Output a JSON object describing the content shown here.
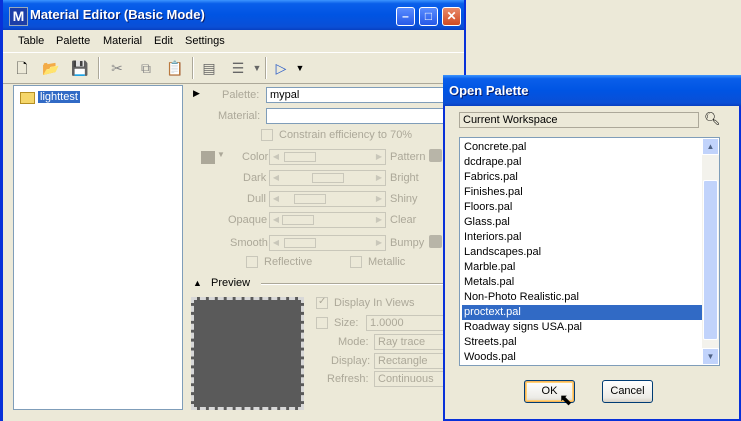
{
  "main": {
    "title": "Material Editor (Basic Mode)",
    "app_icon": "M",
    "menu": [
      "Table",
      "Palette",
      "Material",
      "Edit",
      "Settings"
    ],
    "tree": {
      "selected": "lighttest"
    },
    "form": {
      "palette_label": "Palette:",
      "palette_value": "mypal",
      "material_label": "Material:",
      "material_value": "",
      "constrain_label": "Constrain efficiency to 70%",
      "color_label": "Color",
      "pattern_label": "Pattern",
      "dark_label": "Dark",
      "bright_label": "Bright",
      "dull_label": "Dull",
      "shiny_label": "Shiny",
      "opaque_label": "Opaque",
      "clear_label": "Clear",
      "smooth_label": "Smooth",
      "bumpy_label": "Bumpy",
      "reflective_label": "Reflective",
      "metallic_label": "Metallic"
    },
    "preview": {
      "header": "Preview",
      "display_in_views": "Display In Views",
      "size_label": "Size:",
      "size_value": "1.0000",
      "mode_label": "Mode:",
      "mode_value": "Ray trace",
      "display_label": "Display:",
      "display_value": "Rectangle",
      "refresh_label": "Refresh:",
      "refresh_value": "Continuous"
    }
  },
  "dialog": {
    "title": "Open Palette",
    "location": "Current Workspace",
    "files": [
      "Concrete.pal",
      "dcdrape.pal",
      "Fabrics.pal",
      "Finishes.pal",
      "Floors.pal",
      "Glass.pal",
      "Interiors.pal",
      "Landscapes.pal",
      "Marble.pal",
      "Metals.pal",
      "Non-Photo Realistic.pal",
      "proctext.pal",
      "Roadway signs USA.pal",
      "Streets.pal",
      "Woods.pal"
    ],
    "selected_index": 11,
    "ok_label": "OK",
    "cancel_label": "Cancel"
  },
  "colors": {
    "titlebar": "#0054e3",
    "selection": "#316ac5",
    "face": "#ece9d8"
  }
}
